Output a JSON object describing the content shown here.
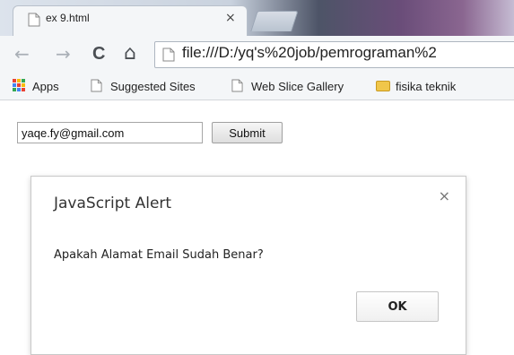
{
  "browser": {
    "tab_title": "ex 9.html",
    "tab_close": "×",
    "address": "file:///D:/yq's%20job/pemrograman%2",
    "nav_icons": {
      "back": "←",
      "forward": "→",
      "reload": "C",
      "home": "⌂"
    }
  },
  "bookmarks": [
    {
      "label": "Apps",
      "icon": "apps-grid-icon"
    },
    {
      "label": "Suggested Sites",
      "icon": "page-icon"
    },
    {
      "label": "Web Slice Gallery",
      "icon": "page-icon"
    },
    {
      "label": "fisika teknik",
      "icon": "folder-icon"
    }
  ],
  "form": {
    "email_value": "yaqe.fy@gmail.com",
    "submit_label": "Submit"
  },
  "alert": {
    "title": "JavaScript Alert",
    "close": "×",
    "message": "Apakah Alamat Email Sudah Benar?",
    "ok_label": "OK"
  },
  "colors": {
    "apps_grid": [
      "#e94335",
      "#fbbc05",
      "#34a853",
      "#4285f4",
      "#e94335",
      "#fbbc05",
      "#34a853",
      "#4285f4",
      "#e94335"
    ]
  }
}
